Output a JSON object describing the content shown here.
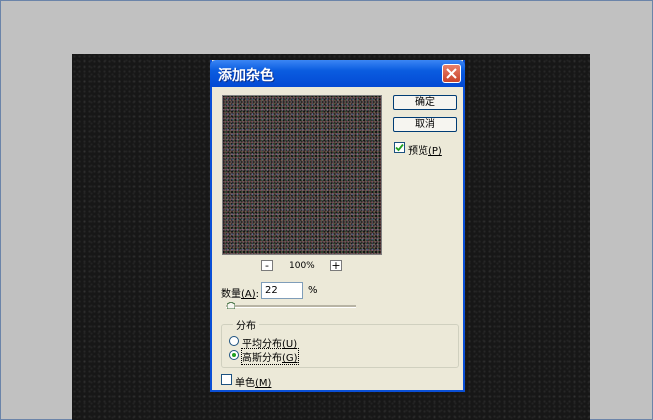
{
  "dialog": {
    "title": "添加杂色",
    "ok_label": "确定",
    "cancel_label": "取消",
    "preview_label": "预览",
    "preview_key": "(P)",
    "preview_checked": true,
    "zoom": {
      "minus": "-",
      "level": "100%",
      "plus": "+"
    },
    "amount": {
      "label": "数量",
      "key": "(A)",
      "colon": ":",
      "value": "22",
      "unit": "%"
    },
    "distribution": {
      "title": "分布",
      "options": [
        {
          "label": "平均分布",
          "key": "(U)",
          "selected": false
        },
        {
          "label": "高斯分布",
          "key": "(G)",
          "selected": true
        }
      ]
    },
    "mono_label": "单色",
    "mono_key": "(M)",
    "mono_checked": false
  },
  "colors": {
    "accent": "#0a5ce0",
    "dialog_bg": "#ece9d8",
    "canvas": "#171717"
  }
}
